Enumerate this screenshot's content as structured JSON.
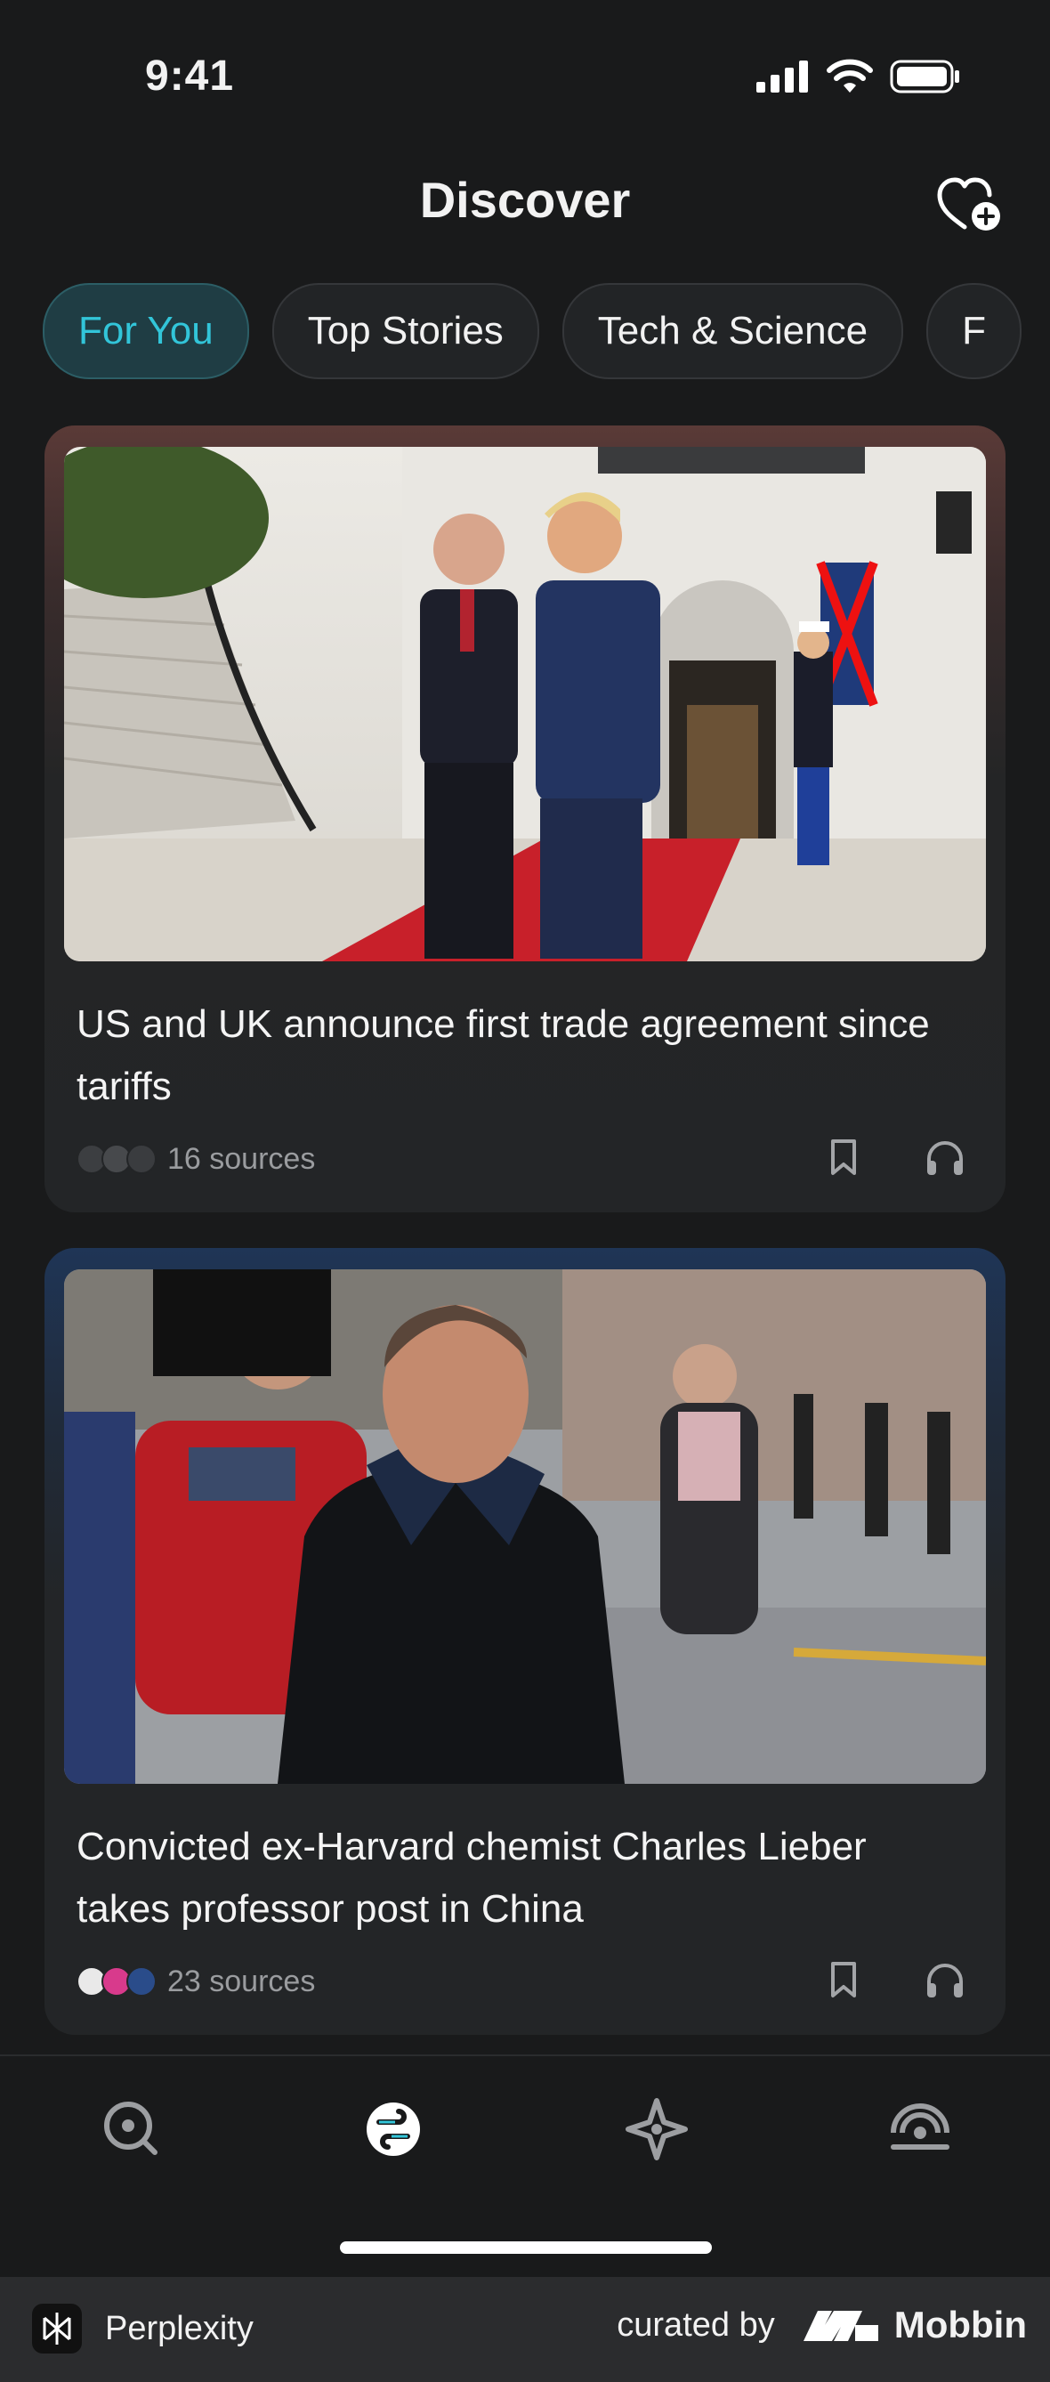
{
  "status_bar": {
    "time": "9:41"
  },
  "header": {
    "title": "Discover"
  },
  "tabs": [
    {
      "label": "For You",
      "active": true
    },
    {
      "label": "Top Stories",
      "active": false
    },
    {
      "label": "Tech & Science",
      "active": false
    },
    {
      "label": "F",
      "active": false
    }
  ],
  "cards": [
    {
      "title": "US and UK announce first trade agreement since tariffs",
      "sources": "16 sources"
    },
    {
      "title": "Convicted ex-Harvard chemist Charles Lieber takes professor post in China",
      "sources": "23 sources"
    }
  ],
  "bottom_nav": [
    {
      "icon": "search-icon"
    },
    {
      "icon": "discover-icon",
      "active": true
    },
    {
      "icon": "spaces-icon"
    },
    {
      "icon": "library-icon"
    }
  ],
  "footer": {
    "app_name": "Perplexity",
    "curated_label": "curated by",
    "curator": "Mobbin"
  },
  "colors": {
    "accent": "#32c5d9",
    "background": "#191a1b",
    "card": "#232527"
  }
}
